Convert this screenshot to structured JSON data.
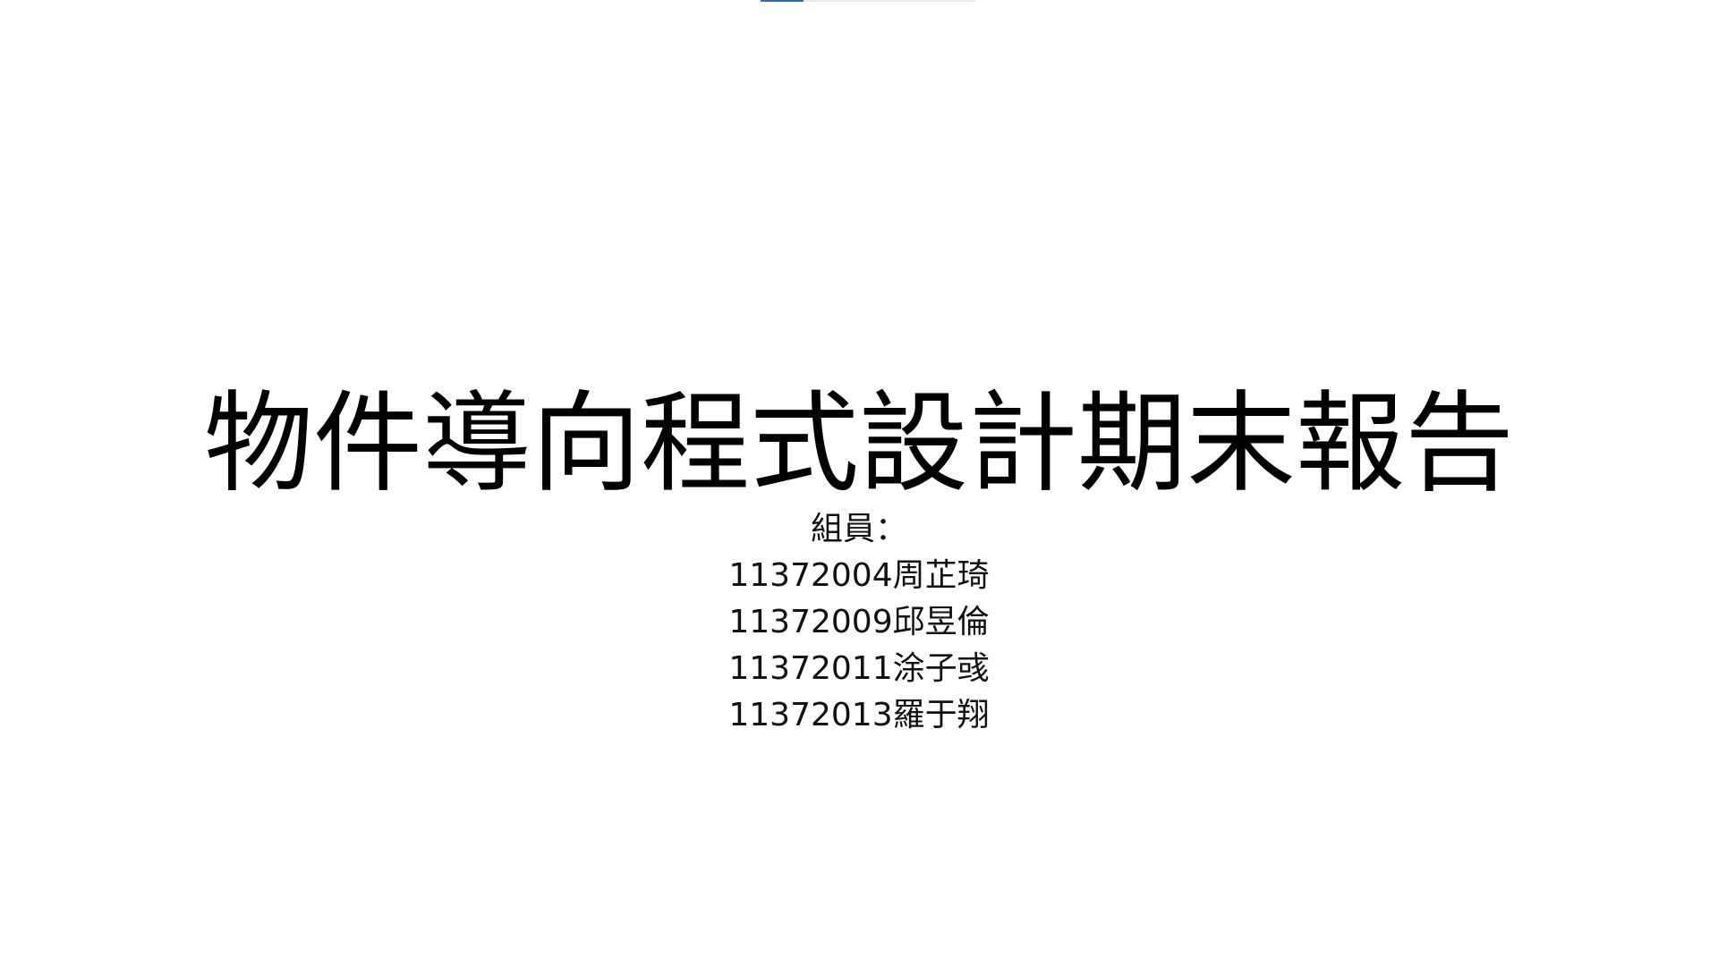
{
  "progress": {
    "value": 0.2,
    "accent": "#1f6fd1"
  },
  "slide": {
    "title": "物件導向程式設計期末報告",
    "members_heading": "組員：",
    "members": [
      "11372004周芷琦",
      "11372009邱昱倫",
      "11372011涂子彧",
      "11372013羅于翔"
    ]
  }
}
